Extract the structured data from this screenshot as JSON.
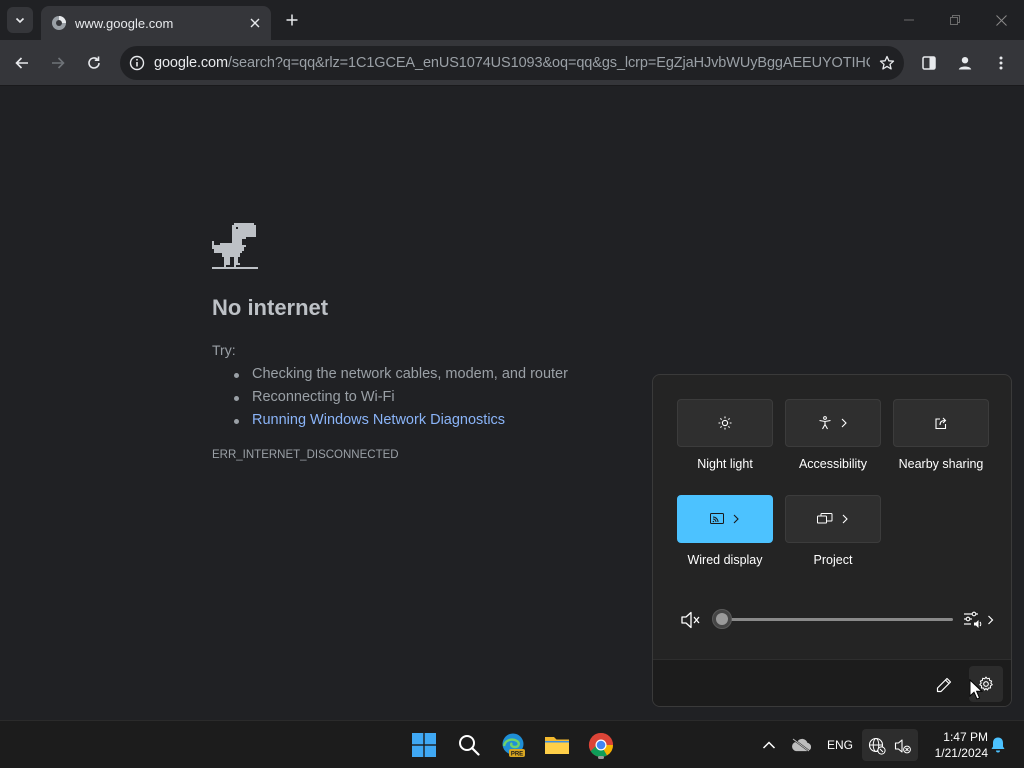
{
  "browser": {
    "tab": {
      "title": "www.google.com"
    },
    "address_bar": {
      "host": "google.com",
      "path": "/search?q=qq&rlz=1C1GCEA_enUS1074US1093&oq=qq&gs_lcrp=EgZjaHJvbWUyBggAEEUYOTIHCA..."
    }
  },
  "error_page": {
    "title": "No internet",
    "try_label": "Try:",
    "suggestions": [
      "Checking the network cables, modem, and router",
      "Reconnecting to Wi-Fi",
      "Running Windows Network Diagnostics"
    ],
    "error_code": "ERR_INTERNET_DISCONNECTED"
  },
  "quick_settings": {
    "tiles": [
      {
        "label": "Night light",
        "active": false,
        "chevron": false,
        "icon": "brightness-icon"
      },
      {
        "label": "Accessibility",
        "active": false,
        "chevron": true,
        "icon": "accessibility-icon"
      },
      {
        "label": "Nearby sharing",
        "active": false,
        "chevron": false,
        "icon": "share-icon"
      },
      {
        "label": "Wired display",
        "active": true,
        "chevron": true,
        "icon": "cast-icon"
      },
      {
        "label": "Project",
        "active": false,
        "chevron": true,
        "icon": "project-icon"
      }
    ],
    "volume": {
      "level": 0,
      "muted": true
    },
    "accent_color": "#4cc2ff"
  },
  "taskbar": {
    "apps": [
      "start-icon",
      "search-icon",
      "edge-beta-icon",
      "file-explorer-icon",
      "chrome-icon"
    ],
    "edge_badge": "PRE",
    "language": "ENG",
    "time": "1:47 PM",
    "date": "1/21/2024"
  }
}
